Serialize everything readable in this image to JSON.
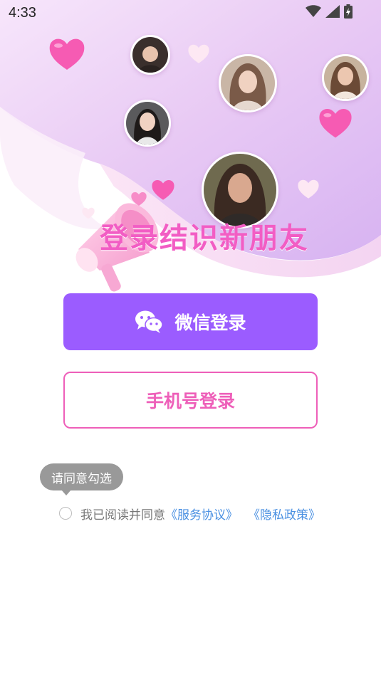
{
  "status_bar": {
    "time": "4:33",
    "icons": [
      "wifi-icon",
      "signal-icon",
      "battery-charging-icon"
    ]
  },
  "hero": {
    "tagline": "登录结识新朋友",
    "avatars": [
      "avatar-1",
      "avatar-2",
      "avatar-3",
      "avatar-4",
      "avatar-5"
    ]
  },
  "login": {
    "wechat_label": "微信登录",
    "wechat_icon": "wechat-icon",
    "phone_label": "手机号登录"
  },
  "agreement": {
    "tooltip": "请同意勾选",
    "prefix": "我已阅读并同意",
    "service_link": "《服务协议》",
    "privacy_link": "《隐私政策》"
  },
  "colors": {
    "wechat_button": "#9b5cff",
    "phone_accent": "#ee5fb9",
    "link": "#4a90e2",
    "tagline": "#f25dc4"
  }
}
